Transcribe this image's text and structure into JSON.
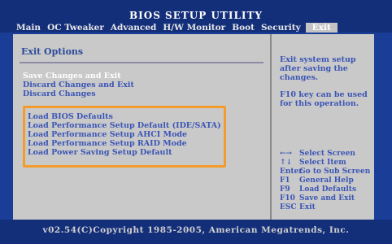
{
  "title": "BIOS SETUP UTILITY",
  "menu": [
    "Main",
    "OC Tweaker",
    "Advanced",
    "H/W Monitor",
    "Boot",
    "Security",
    "Exit"
  ],
  "menu_active": "Exit",
  "section_title": "Exit Options",
  "options_group1": [
    "Save Changes and Exit",
    "Discard Changes and Exit",
    "Discard Changes"
  ],
  "options_group2": [
    "Load BIOS Defaults",
    "Load Performance Setup Default (IDE/SATA)",
    "Load Performance Setup AHCI Mode",
    "Load Performance Setup RAID Mode",
    "Load Power Saving Setup Default"
  ],
  "selected_option": "Save Changes and Exit",
  "help_text": [
    "Exit system setup after saving the changes.",
    "F10 key can be used for this operation."
  ],
  "keys": [
    {
      "key": "←→",
      "desc": "Select Screen"
    },
    {
      "key": "↑↓",
      "desc": "Select Item"
    },
    {
      "key": "Enter",
      "desc": "Go to Sub Screen"
    },
    {
      "key": "F1",
      "desc": "General Help"
    },
    {
      "key": "F9",
      "desc": "Load Defaults"
    },
    {
      "key": "F10",
      "desc": "Save and Exit"
    },
    {
      "key": "ESC",
      "desc": "Exit"
    }
  ],
  "copyright": "v02.54(C)Copyright 1985-2005, American Megatrends, Inc.",
  "colors": {
    "background": "#1a3e98",
    "panel": "#c9c9c9",
    "text_blue": "#3b55b5",
    "highlight_border": "#f39c2b"
  }
}
